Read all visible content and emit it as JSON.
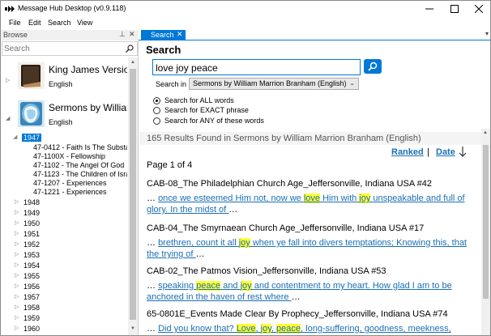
{
  "window": {
    "title": "Message Hub Desktop (v0.9.118)",
    "minimize_glyph": "—",
    "maximize_glyph": "☐",
    "close_glyph": "✕"
  },
  "menu": [
    "File",
    "Edit",
    "Search",
    "View"
  ],
  "browse": {
    "title": "Browse",
    "pin_glyph": "⊥",
    "close_glyph": "✕",
    "search_placeholder": "Search",
    "libraries": [
      {
        "name": "King James Version",
        "language": "English",
        "icon": "bible-book-icon"
      },
      {
        "name": "Sermons by William",
        "language": "English",
        "icon": "sermons-icon"
      }
    ],
    "selected_year": "1947",
    "sermons_1947": [
      "47-0412 - Faith Is The Substa",
      "47-1100X - Fellowship",
      "47-1102 - The Angel Of God",
      "47-1123 - The Children of Isra",
      "47-1207 - Experiences",
      "47-1221 - Experiences"
    ],
    "years": [
      "1948",
      "1949",
      "1950",
      "1951",
      "1952",
      "1953",
      "1954",
      "1955",
      "1956",
      "1957",
      "1958",
      "1959",
      "1960"
    ]
  },
  "tab": {
    "label": "Search",
    "close_glyph": "✕"
  },
  "search": {
    "heading": "Search",
    "query": "love joy peace",
    "search_in_label": "Search in",
    "search_in_value": "Sermons by William Marrion Branham (English)",
    "options": [
      {
        "label": "Search for ALL words",
        "selected": true
      },
      {
        "label": "Search for EXACT phrase",
        "selected": false
      },
      {
        "label": "Search for ANY of these words",
        "selected": false
      }
    ]
  },
  "results": {
    "count_text": "165 Results Found in Sermons by William Marrion Branham (English)",
    "sort_ranked": "Ranked",
    "sort_separator": "|",
    "sort_date": "Date",
    "page_text": "Page 1 of 4",
    "items": [
      {
        "title": "CAB-08_The Philadelphian Church Age_Jeffersonville, Indiana USA #42",
        "snippet": [
          {
            "t": "… ",
            "k": "ell"
          },
          {
            "t": "once we esteemed Him not, now we ",
            "k": "u"
          },
          {
            "t": "love",
            "k": "hl"
          },
          {
            "t": " Him with ",
            "k": "u"
          },
          {
            "t": "joy",
            "k": "hl"
          },
          {
            "t": " unspeakable and full of glory. In the midst of ",
            "k": "u"
          },
          {
            "t": "…",
            "k": "ell"
          }
        ]
      },
      {
        "title": "CAB-04_The Smyrnaean Church Age_Jeffersonville, Indiana USA #17",
        "snippet": [
          {
            "t": "… ",
            "k": "ell"
          },
          {
            "t": "brethren, count it all ",
            "k": "u"
          },
          {
            "t": "joy",
            "k": "hl"
          },
          {
            "t": " when ye fall into divers temptations; Knowing this, that the trying of ",
            "k": "u"
          },
          {
            "t": "…",
            "k": "ell"
          }
        ]
      },
      {
        "title": "CAB-02_The Patmos Vision_Jeffersonville, Indiana USA #53",
        "snippet": [
          {
            "t": "… ",
            "k": "ell"
          },
          {
            "t": "speaking ",
            "k": "u"
          },
          {
            "t": "peace",
            "k": "hl"
          },
          {
            "t": " and ",
            "k": "u"
          },
          {
            "t": "joy",
            "k": "hl"
          },
          {
            "t": " and contentment to my heart. How glad I am to be anchored in the haven of rest where ",
            "k": "u"
          },
          {
            "t": "…",
            "k": "ell"
          }
        ]
      },
      {
        "title": "65-0801E_Events Made Clear By Prophecy_Jeffersonville, Indiana USA #74",
        "snippet": [
          {
            "t": "… ",
            "k": "ell"
          },
          {
            "t": "Did you know that? ",
            "k": "u"
          },
          {
            "t": "Love",
            "k": "hl"
          },
          {
            "t": ", ",
            "k": "u"
          },
          {
            "t": "joy",
            "k": "hl"
          },
          {
            "t": ", ",
            "k": "u"
          },
          {
            "t": "peace",
            "k": "hl"
          },
          {
            "t": ", long-suffering, goodness, meekness, gentleness",
            "k": "u"
          }
        ]
      }
    ]
  },
  "colors": {
    "accent": "#0078d7",
    "link": "#1a6fb5",
    "highlight": "#ffff33"
  }
}
